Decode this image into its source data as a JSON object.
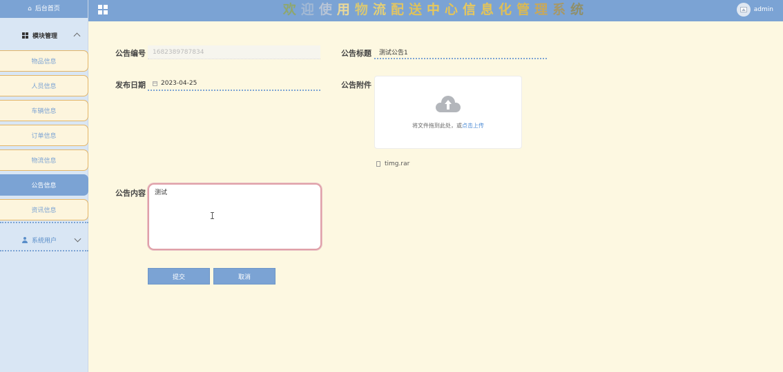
{
  "sidebar": {
    "home_label": "后台首页",
    "group_modules": "模块管理",
    "items": [
      {
        "label": "物品信息"
      },
      {
        "label": "人员信息"
      },
      {
        "label": "车辆信息"
      },
      {
        "label": "订单信息"
      },
      {
        "label": "物流信息"
      },
      {
        "label": "公告信息",
        "active": true
      },
      {
        "label": "资讯信息"
      }
    ],
    "group_users": "系统用户"
  },
  "header": {
    "title": "欢迎使用物流配送中心信息化管理系统",
    "username": "admin"
  },
  "form": {
    "id_label": "公告编号",
    "id_value": "1682389787834",
    "title_label": "公告标题",
    "title_value": "测试公告1",
    "date_label": "发布日期",
    "date_value": "2023-04-25",
    "attachment_label": "公告附件",
    "upload_text": "将文件拖到此处，或",
    "upload_link": "点击上传",
    "file_name": "timg.rar",
    "content_label": "公告内容",
    "content_value": "测试"
  },
  "actions": {
    "submit_label": "提交",
    "cancel_label": "取消"
  },
  "colors": {
    "accent": "#7ba3d4",
    "background": "#fdf8e1",
    "menu_border": "#e3b567"
  }
}
